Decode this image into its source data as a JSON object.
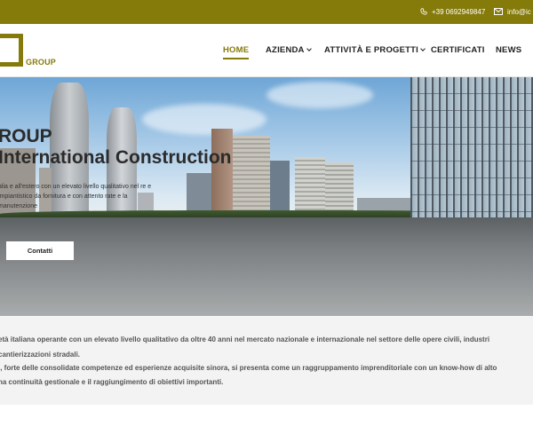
{
  "topbar": {
    "phone": "+39 0692949847",
    "email": "info@ic",
    "phone_icon": "phone-icon",
    "mail_icon": "mail-icon",
    "color": "#857b0a"
  },
  "header": {
    "logo_text": "GROUP",
    "nav": {
      "home": "HOME",
      "azienda": "AZIENDA",
      "attivita": "ATTIVITÀ E PROGETTI",
      "certificati": "CERTIFICATI",
      "news": "NEWS"
    },
    "active": "HOME"
  },
  "hero": {
    "title_line1": "ROUP",
    "title_line2": "International Construction",
    "description": "alia e all'estero con un elevato livello qualitativo nel re e impiantistico da fornitura e con attento rate e la manutenzione",
    "button": "Contatti"
  },
  "intro": {
    "line1": "età italiana operante con un elevato livello qualitativo da oltre 40 anni nel mercato nazionale e internazionale nel settore delle opere civili, industri",
    "line2": "cantierizzazioni stradali.",
    "line3": "., forte delle consolidate competenze ed esperienze acquisite sinora, si presenta come un raggruppamento imprenditoriale con un know-how di alto",
    "line4": "na continuità gestionale e il raggiungimento di obiettivi importanti."
  }
}
